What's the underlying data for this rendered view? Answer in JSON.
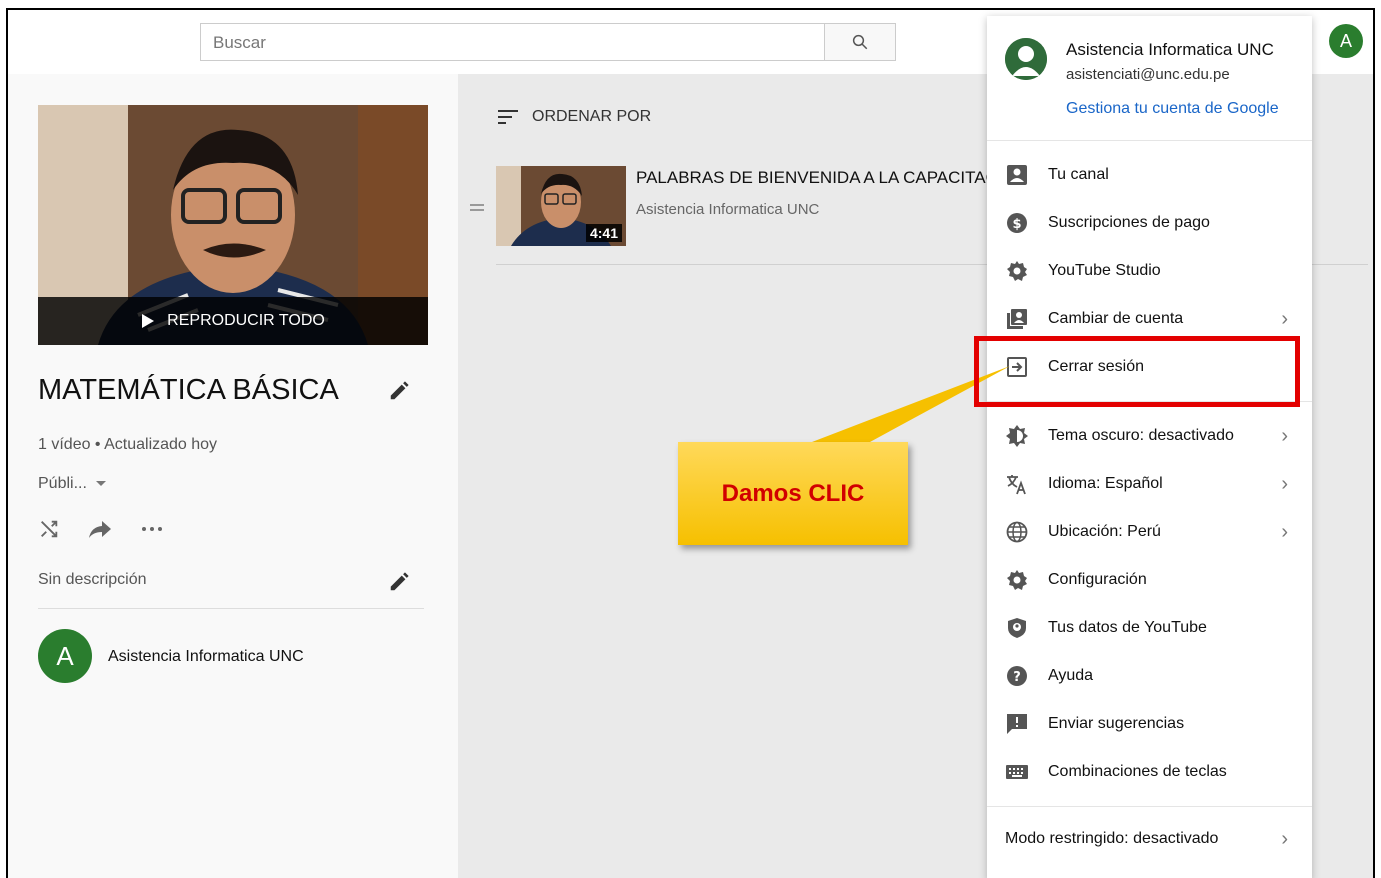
{
  "header": {
    "search_placeholder": "Buscar",
    "avatar_letter": "A"
  },
  "playlist": {
    "play_all_label": "REPRODUCIR TODO",
    "title": "MATEMÁTICA BÁSICA",
    "meta": "1 vídeo • Actualizado hoy",
    "privacy": "Públi...",
    "description": "Sin descripción",
    "owner_letter": "A",
    "owner_name": "Asistencia Informatica UNC"
  },
  "main": {
    "sort_label": "ORDENAR POR",
    "video": {
      "title": "PALABRAS DE BIENVENIDA A LA CAPACITAC",
      "channel": "Asistencia Informatica UNC",
      "duration": "4:41"
    }
  },
  "account_menu": {
    "name": "Asistencia Informatica UNC",
    "email": "asistenciati@unc.edu.pe",
    "manage_label": "Gestiona tu cuenta de Google",
    "items": [
      {
        "label": "Tu canal",
        "icon": "person-box-icon"
      },
      {
        "label": "Suscripciones de pago",
        "icon": "dollar-circle-icon"
      },
      {
        "label": "YouTube Studio",
        "icon": "gear-icon"
      },
      {
        "label": "Cambiar de cuenta",
        "icon": "switch-account-icon"
      },
      {
        "label": "Cerrar sesión",
        "icon": "sign-out-icon"
      },
      {
        "label": "Tema oscuro: desactivado",
        "icon": "dark-theme-icon"
      },
      {
        "label": "Idioma: Español",
        "icon": "translate-icon"
      },
      {
        "label": "Ubicación: Perú",
        "icon": "globe-icon"
      },
      {
        "label": "Configuración",
        "icon": "gear-icon"
      },
      {
        "label": "Tus datos de YouTube",
        "icon": "shield-person-icon"
      },
      {
        "label": "Ayuda",
        "icon": "help-icon"
      },
      {
        "label": "Enviar sugerencias",
        "icon": "feedback-icon"
      },
      {
        "label": "Combinaciones de teclas",
        "icon": "keyboard-icon"
      },
      {
        "label": "Modo restringido: desactivado",
        "icon": ""
      }
    ]
  },
  "annotation": {
    "callout_text": "Damos CLIC",
    "highlight_color": "#e30000",
    "callout_color": "#f6c000"
  }
}
